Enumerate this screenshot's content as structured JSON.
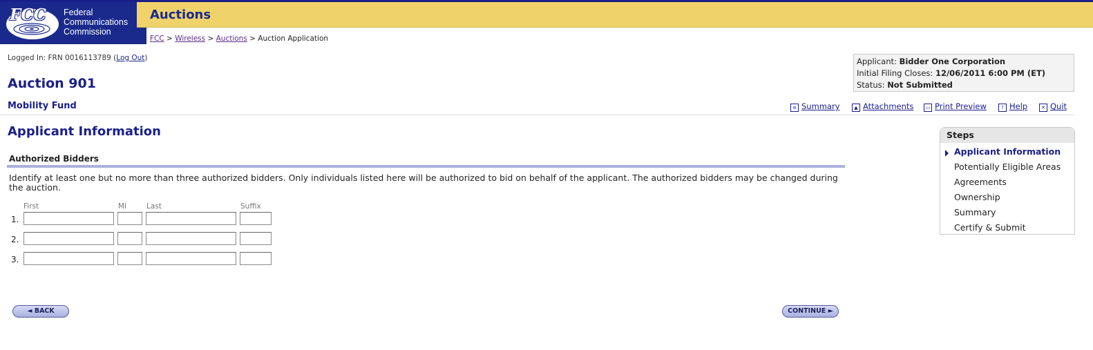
{
  "header": {
    "logo_text": "FCC",
    "agency_name": [
      "Federal",
      "Communications",
      "Commission"
    ],
    "banner_title": "Auctions",
    "breadcrumb": [
      {
        "label": "FCC"
      },
      {
        "label": "Wireless"
      },
      {
        "label": "Auctions"
      },
      {
        "label": "Auction Application"
      }
    ],
    "breadcrumb_sep": " > "
  },
  "session": {
    "logged_prefix": "Logged In: FRN 0016113789 (",
    "logout_label": "Log Out",
    "logged_suffix": ")"
  },
  "auction": {
    "title": "Auction 901",
    "subtitle": "Mobility Fund"
  },
  "status_box": {
    "applicant_label": "Applicant: ",
    "applicant_value": "Bidder One Corporation",
    "closes_label": "Initial Filing Closes: ",
    "closes_value": "12/06/2011 6:00 PM (ET)",
    "status_label": "Status: ",
    "status_value": "Not Submitted"
  },
  "actions": [
    {
      "label": "Summary",
      "icon": "summary-icon"
    },
    {
      "label": "Attachments",
      "icon": "attachments-icon"
    },
    {
      "label": "Print Preview",
      "icon": "print-icon"
    },
    {
      "label": "Help",
      "icon": "help-icon"
    },
    {
      "label": "Quit",
      "icon": "quit-icon"
    }
  ],
  "section": {
    "title": "Applicant Information",
    "subheading": "Authorized Bidders",
    "description": "Identify at least one but no more than three authorized bidders. Only individuals listed here will be authorized to bid on behalf of the applicant. The authorized bidders may be changed during the auction."
  },
  "form": {
    "columns": [
      "First",
      "MI",
      "Last",
      "Suffix"
    ],
    "rows": [
      {
        "label": "1.",
        "first": "",
        "mi": "",
        "last": "",
        "suffix": ""
      },
      {
        "label": "2.",
        "first": "",
        "mi": "",
        "last": "",
        "suffix": ""
      },
      {
        "label": "3.",
        "first": "",
        "mi": "",
        "last": "",
        "suffix": ""
      }
    ]
  },
  "steps": {
    "heading": "Steps",
    "items": [
      {
        "label": "Applicant Information",
        "active": true
      },
      {
        "label": "Potentially Eligible Areas",
        "active": false
      },
      {
        "label": "Agreements",
        "active": false
      },
      {
        "label": "Ownership",
        "active": false
      },
      {
        "label": "Summary",
        "active": false
      },
      {
        "label": "Certify & Submit",
        "active": false
      }
    ]
  },
  "buttons": {
    "back": "◄ BACK",
    "continue": "CONTINUE ►"
  },
  "colors": {
    "brand_navy": "#1a2a8c",
    "banner_gold": "#f0d26a",
    "rule_lavender": "#aab0dc"
  }
}
